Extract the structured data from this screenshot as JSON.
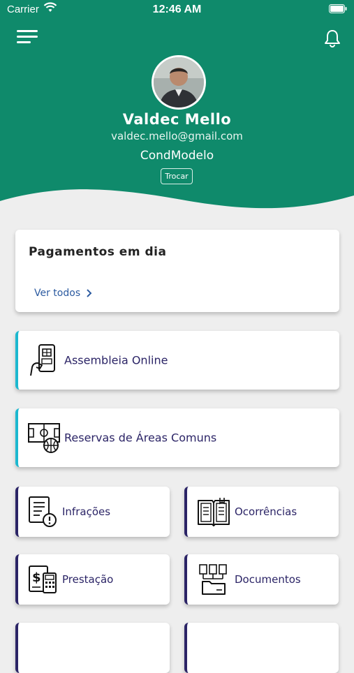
{
  "status_bar": {
    "carrier": "Carrier",
    "time": "12:46 AM"
  },
  "header": {
    "menu_icon": "hamburger-menu-icon",
    "bell_icon": "bell-icon",
    "user_name": "Valdec Mello",
    "user_email": "valdec.mello@gmail.com",
    "condo_name": "CondModelo",
    "switch_label": "Trocar"
  },
  "payments_card": {
    "title": "Pagamentos em dia",
    "link_label": "Ver todos"
  },
  "features": [
    {
      "label": "Assembleia Online",
      "icon": "vote-phone-icon"
    },
    {
      "label": "Reservas de Áreas Comuns",
      "icon": "sports-court-icon"
    }
  ],
  "grid": [
    {
      "label": "Infrações",
      "icon": "infraction-document-icon"
    },
    {
      "label": "Ocorrências",
      "icon": "open-book-icon"
    },
    {
      "label": "Prestação",
      "icon": "accounting-icon"
    },
    {
      "label": "Documentos",
      "icon": "documents-folder-icon"
    }
  ],
  "colors": {
    "primary": "#0f8a6b",
    "accent": "#1cb8cf",
    "navy": "#2b2466",
    "link": "#2b5aa0"
  }
}
